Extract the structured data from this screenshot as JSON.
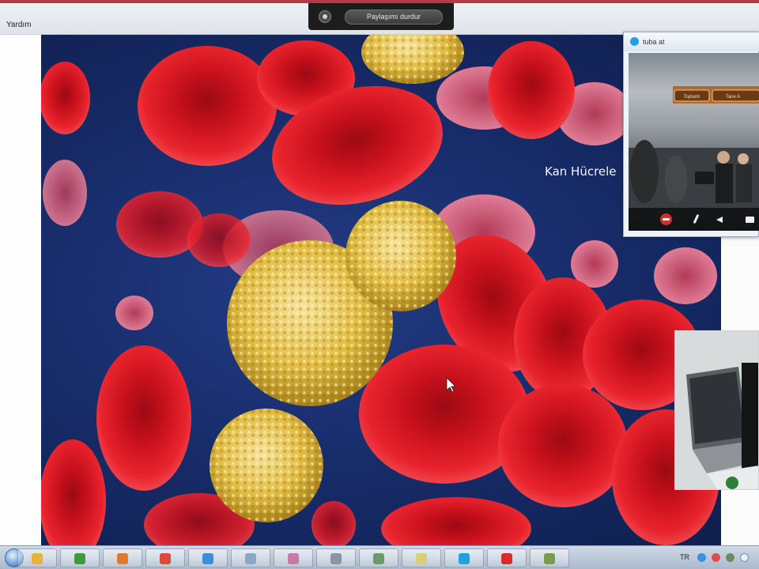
{
  "app": {
    "menu": {
      "help_label": "Yardım"
    }
  },
  "share_bar": {
    "icon": "screen-share-icon",
    "stop_label": "Paylaşımı durdur"
  },
  "slide": {
    "caption": "Kan Hücrele"
  },
  "call_window": {
    "title": "tuba at",
    "icon": "skype-icon",
    "controls": [
      "end-call-icon",
      "microphone-icon",
      "volume-icon",
      "camera-icon"
    ],
    "video_banner": [
      "Toplantı",
      "Tane A"
    ]
  },
  "self_view": {
    "label": ""
  },
  "taskbar": {
    "apps": [
      "windows-explorer-icon",
      "checkmark-icon",
      "firefox-icon",
      "chrome-icon",
      "globe-icon",
      "grid-app-icon",
      "paint-icon",
      "email-icon",
      "media-icon",
      "notepad-icon",
      "skype-icon",
      "pdf-icon",
      "tools-icon"
    ],
    "tray_text": "TR"
  },
  "colors": {
    "accent_red": "#b53a45",
    "slide_background": "#1a2f70",
    "red_cell": "#d8141f",
    "white_cell": "#e3c04a",
    "skype_blue": "#1ea2e4",
    "end_call_red": "#d32d2d"
  }
}
